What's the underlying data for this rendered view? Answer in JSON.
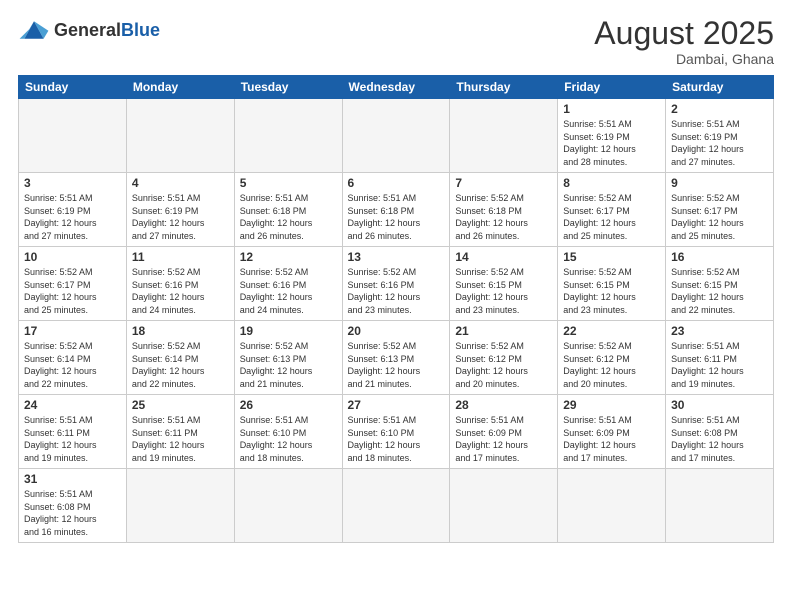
{
  "header": {
    "logo_general": "General",
    "logo_blue": "Blue",
    "month_year": "August 2025",
    "location": "Dambai, Ghana"
  },
  "days_of_week": [
    "Sunday",
    "Monday",
    "Tuesday",
    "Wednesday",
    "Thursday",
    "Friday",
    "Saturday"
  ],
  "weeks": [
    [
      {
        "day": "",
        "info": "",
        "empty": true
      },
      {
        "day": "",
        "info": "",
        "empty": true
      },
      {
        "day": "",
        "info": "",
        "empty": true
      },
      {
        "day": "",
        "info": "",
        "empty": true
      },
      {
        "day": "",
        "info": "",
        "empty": true
      },
      {
        "day": "1",
        "info": "Sunrise: 5:51 AM\nSunset: 6:19 PM\nDaylight: 12 hours\nand 28 minutes."
      },
      {
        "day": "2",
        "info": "Sunrise: 5:51 AM\nSunset: 6:19 PM\nDaylight: 12 hours\nand 27 minutes."
      }
    ],
    [
      {
        "day": "3",
        "info": "Sunrise: 5:51 AM\nSunset: 6:19 PM\nDaylight: 12 hours\nand 27 minutes."
      },
      {
        "day": "4",
        "info": "Sunrise: 5:51 AM\nSunset: 6:19 PM\nDaylight: 12 hours\nand 27 minutes."
      },
      {
        "day": "5",
        "info": "Sunrise: 5:51 AM\nSunset: 6:18 PM\nDaylight: 12 hours\nand 26 minutes."
      },
      {
        "day": "6",
        "info": "Sunrise: 5:51 AM\nSunset: 6:18 PM\nDaylight: 12 hours\nand 26 minutes."
      },
      {
        "day": "7",
        "info": "Sunrise: 5:52 AM\nSunset: 6:18 PM\nDaylight: 12 hours\nand 26 minutes."
      },
      {
        "day": "8",
        "info": "Sunrise: 5:52 AM\nSunset: 6:17 PM\nDaylight: 12 hours\nand 25 minutes."
      },
      {
        "day": "9",
        "info": "Sunrise: 5:52 AM\nSunset: 6:17 PM\nDaylight: 12 hours\nand 25 minutes."
      }
    ],
    [
      {
        "day": "10",
        "info": "Sunrise: 5:52 AM\nSunset: 6:17 PM\nDaylight: 12 hours\nand 25 minutes."
      },
      {
        "day": "11",
        "info": "Sunrise: 5:52 AM\nSunset: 6:16 PM\nDaylight: 12 hours\nand 24 minutes."
      },
      {
        "day": "12",
        "info": "Sunrise: 5:52 AM\nSunset: 6:16 PM\nDaylight: 12 hours\nand 24 minutes."
      },
      {
        "day": "13",
        "info": "Sunrise: 5:52 AM\nSunset: 6:16 PM\nDaylight: 12 hours\nand 23 minutes."
      },
      {
        "day": "14",
        "info": "Sunrise: 5:52 AM\nSunset: 6:15 PM\nDaylight: 12 hours\nand 23 minutes."
      },
      {
        "day": "15",
        "info": "Sunrise: 5:52 AM\nSunset: 6:15 PM\nDaylight: 12 hours\nand 23 minutes."
      },
      {
        "day": "16",
        "info": "Sunrise: 5:52 AM\nSunset: 6:15 PM\nDaylight: 12 hours\nand 22 minutes."
      }
    ],
    [
      {
        "day": "17",
        "info": "Sunrise: 5:52 AM\nSunset: 6:14 PM\nDaylight: 12 hours\nand 22 minutes."
      },
      {
        "day": "18",
        "info": "Sunrise: 5:52 AM\nSunset: 6:14 PM\nDaylight: 12 hours\nand 22 minutes."
      },
      {
        "day": "19",
        "info": "Sunrise: 5:52 AM\nSunset: 6:13 PM\nDaylight: 12 hours\nand 21 minutes."
      },
      {
        "day": "20",
        "info": "Sunrise: 5:52 AM\nSunset: 6:13 PM\nDaylight: 12 hours\nand 21 minutes."
      },
      {
        "day": "21",
        "info": "Sunrise: 5:52 AM\nSunset: 6:12 PM\nDaylight: 12 hours\nand 20 minutes."
      },
      {
        "day": "22",
        "info": "Sunrise: 5:52 AM\nSunset: 6:12 PM\nDaylight: 12 hours\nand 20 minutes."
      },
      {
        "day": "23",
        "info": "Sunrise: 5:51 AM\nSunset: 6:11 PM\nDaylight: 12 hours\nand 19 minutes."
      }
    ],
    [
      {
        "day": "24",
        "info": "Sunrise: 5:51 AM\nSunset: 6:11 PM\nDaylight: 12 hours\nand 19 minutes."
      },
      {
        "day": "25",
        "info": "Sunrise: 5:51 AM\nSunset: 6:11 PM\nDaylight: 12 hours\nand 19 minutes."
      },
      {
        "day": "26",
        "info": "Sunrise: 5:51 AM\nSunset: 6:10 PM\nDaylight: 12 hours\nand 18 minutes."
      },
      {
        "day": "27",
        "info": "Sunrise: 5:51 AM\nSunset: 6:10 PM\nDaylight: 12 hours\nand 18 minutes."
      },
      {
        "day": "28",
        "info": "Sunrise: 5:51 AM\nSunset: 6:09 PM\nDaylight: 12 hours\nand 17 minutes."
      },
      {
        "day": "29",
        "info": "Sunrise: 5:51 AM\nSunset: 6:09 PM\nDaylight: 12 hours\nand 17 minutes."
      },
      {
        "day": "30",
        "info": "Sunrise: 5:51 AM\nSunset: 6:08 PM\nDaylight: 12 hours\nand 17 minutes."
      }
    ],
    [
      {
        "day": "31",
        "info": "Sunrise: 5:51 AM\nSunset: 6:08 PM\nDaylight: 12 hours\nand 16 minutes.",
        "last": true
      },
      {
        "day": "",
        "info": "",
        "empty": true,
        "last": true
      },
      {
        "day": "",
        "info": "",
        "empty": true,
        "last": true
      },
      {
        "day": "",
        "info": "",
        "empty": true,
        "last": true
      },
      {
        "day": "",
        "info": "",
        "empty": true,
        "last": true
      },
      {
        "day": "",
        "info": "",
        "empty": true,
        "last": true
      },
      {
        "day": "",
        "info": "",
        "empty": true,
        "last": true
      }
    ]
  ]
}
